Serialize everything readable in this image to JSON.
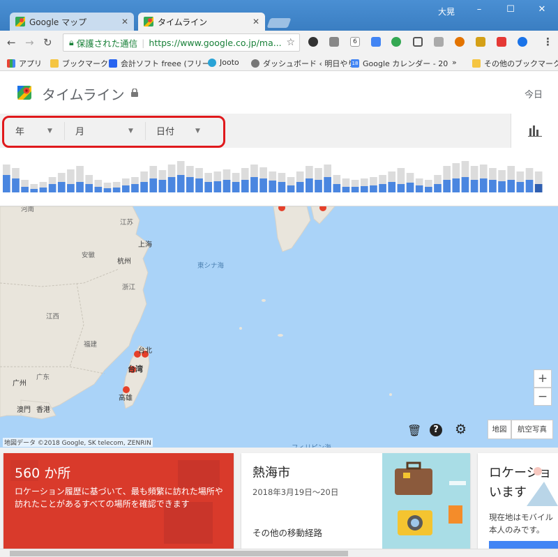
{
  "browser": {
    "tabs": [
      {
        "title": "Google マップ"
      },
      {
        "title": "タイムライン"
      }
    ],
    "user_name": "大晃",
    "address": {
      "secure_text": "保護された通信",
      "url": "https://www.google.co.jp/ma..."
    },
    "extensions": {
      "badge": "6"
    },
    "bookmarks": [
      {
        "label": "アプリ"
      },
      {
        "label": "ブックマーク"
      },
      {
        "label": "会計ソフト freee (フリー"
      },
      {
        "label": "Jooto"
      },
      {
        "label": "ダッシュボード ‹ 明日やり"
      },
      {
        "label": "Google カレンダー - 20"
      },
      {
        "label": "»"
      },
      {
        "label": "その他のブックマーク"
      }
    ],
    "calendar_icon_num": "18",
    "window_controls": {
      "minimize": "–",
      "maximize": "☐",
      "close": "✕"
    }
  },
  "app": {
    "title": "タイムライン",
    "today": "今日",
    "filters": {
      "year": "年",
      "month": "月",
      "day": "日付"
    }
  },
  "histogram": {
    "total": [
      40,
      35,
      18,
      12,
      15,
      22,
      28,
      33,
      38,
      25,
      18,
      14,
      15,
      20,
      22,
      30,
      38,
      32,
      40,
      45,
      38,
      35,
      28,
      30,
      33,
      28,
      35,
      40,
      36,
      30,
      28,
      22,
      30,
      38,
      35,
      40,
      25,
      20,
      18,
      20,
      22,
      25,
      30,
      35,
      28,
      20,
      18,
      25,
      38,
      42,
      45,
      38,
      40,
      35,
      32,
      38,
      30,
      35,
      30
    ],
    "filled": [
      25,
      20,
      8,
      5,
      7,
      12,
      15,
      12,
      15,
      12,
      8,
      6,
      7,
      10,
      12,
      15,
      20,
      18,
      22,
      25,
      22,
      20,
      15,
      16,
      18,
      15,
      18,
      22,
      20,
      17,
      15,
      10,
      15,
      20,
      18,
      22,
      12,
      8,
      8,
      9,
      10,
      12,
      15,
      12,
      14,
      10,
      8,
      12,
      18,
      20,
      22,
      18,
      20,
      18,
      16,
      18,
      15,
      18,
      12
    ],
    "range": [
      0,
      50
    ]
  },
  "map": {
    "labels": [
      {
        "text": "河南",
        "kind": "province"
      },
      {
        "text": "江苏",
        "kind": "province"
      },
      {
        "text": "上海",
        "kind": "city"
      },
      {
        "text": "安徽",
        "kind": "province"
      },
      {
        "text": "杭州",
        "kind": "city"
      },
      {
        "text": "浙江",
        "kind": "province"
      },
      {
        "text": "江西",
        "kind": "province"
      },
      {
        "text": "福建",
        "kind": "province"
      },
      {
        "text": "東シナ海",
        "kind": "sea"
      },
      {
        "text": "台北",
        "kind": "city"
      },
      {
        "text": "台湾",
        "kind": "country"
      },
      {
        "text": "高雄",
        "kind": "city"
      },
      {
        "text": "广州",
        "kind": "city"
      },
      {
        "text": "广东",
        "kind": "province"
      },
      {
        "text": "澳門",
        "kind": "city"
      },
      {
        "text": "香港",
        "kind": "city"
      },
      {
        "text": "フィリピン海",
        "kind": "sea"
      }
    ],
    "attribution": "地図データ ©2018 Google, SK telecom, ZENRIN",
    "zoom_in": "+",
    "zoom_out": "−",
    "map_type_map": "地図",
    "map_type_aerial": "航空写真"
  },
  "cards": {
    "places": {
      "count": "560 か所",
      "description": "ロケーション履歴に基づいて、最も頻繁に訪れた場所や訪れたことがあるすべての場所を確認できます"
    },
    "trip": {
      "title": "熱海市",
      "dates": "2018年3月19日～20日",
      "other_routes": "その他の移動経路"
    },
    "location": {
      "title_line1": "ロケーショ",
      "title_line2": "います",
      "body_line1": "現在地はモバイル",
      "body_line2": "本人のみです。"
    }
  },
  "colors": {
    "titlebar": "#3a7ec2",
    "highlight": "#e0191c",
    "bar_total": "#dcdcdc",
    "bar_filled": "#4a86e0",
    "map_water": "#aad3f8",
    "map_land": "#e8e4dc",
    "marker": "#e5402a",
    "card_red": "#d93a2b"
  }
}
